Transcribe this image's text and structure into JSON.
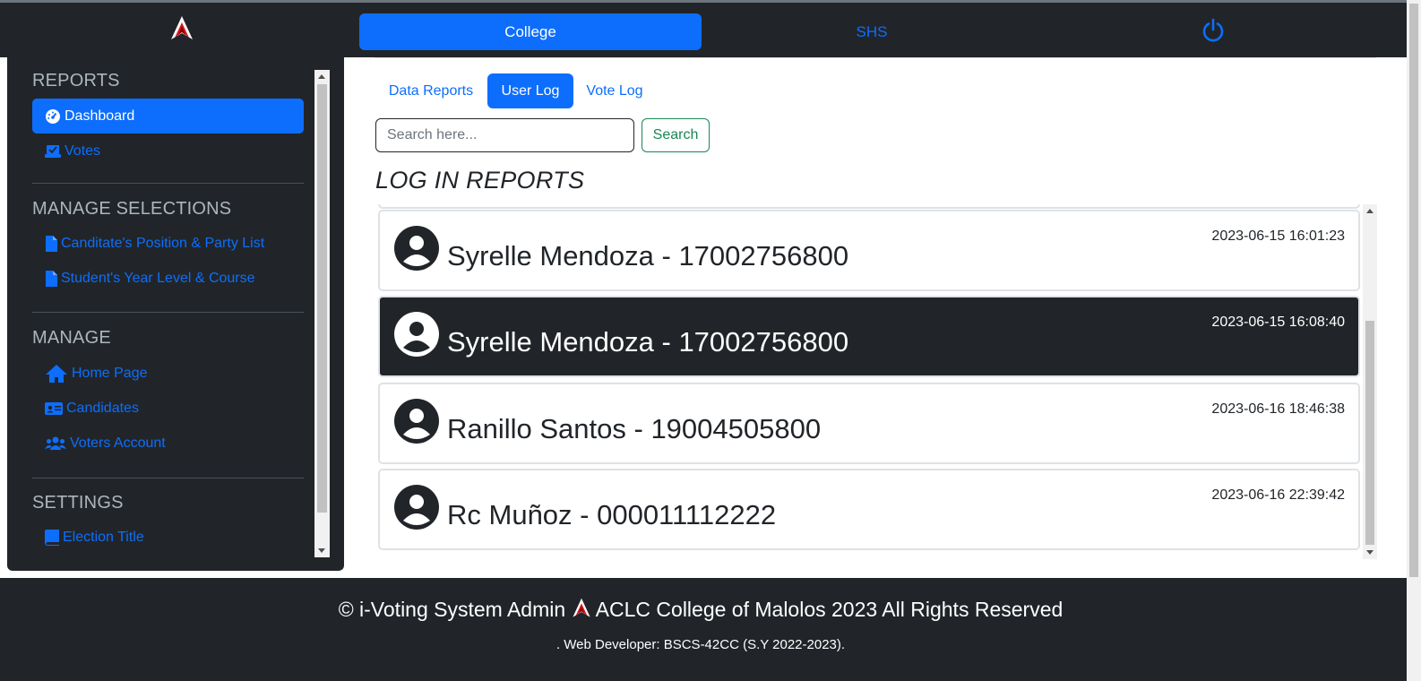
{
  "nav": {
    "tabs": [
      {
        "label": "College",
        "active": true
      },
      {
        "label": "SHS",
        "active": false
      }
    ],
    "logo_icon": "aclc-logo",
    "power_icon": "power-icon"
  },
  "sidebar": {
    "sections": [
      {
        "title": "REPORTS",
        "items": [
          {
            "label": "Dashboard",
            "icon": "gauge-icon",
            "active": true
          },
          {
            "label": "Votes",
            "icon": "ballot-box-icon",
            "active": false
          }
        ]
      },
      {
        "title": "MANAGE SELECTIONS",
        "items": [
          {
            "label": "Canditate's Position & Party List",
            "icon": "file-icon"
          },
          {
            "label": "Student's Year Level & Course",
            "icon": "file-icon"
          }
        ]
      },
      {
        "title": "MANAGE",
        "items": [
          {
            "label": "Home Page",
            "icon": "home-icon"
          },
          {
            "label": "Candidates",
            "icon": "id-card-icon"
          },
          {
            "label": "Voters Account",
            "icon": "users-icon"
          }
        ]
      },
      {
        "title": "SETTINGS",
        "items": [
          {
            "label": "Election Title",
            "icon": "book-icon"
          }
        ]
      }
    ]
  },
  "main": {
    "tabs": [
      {
        "label": "Data Reports",
        "active": false
      },
      {
        "label": "User Log",
        "active": true
      },
      {
        "label": "Vote Log",
        "active": false
      }
    ],
    "search": {
      "placeholder": "Search here...",
      "button": "Search"
    },
    "title": "LOG IN REPORTS",
    "logs": [
      {
        "name": "Syrelle Mendoza - 17002756800",
        "time": "2023-06-15 16:01:23",
        "highlighted": false
      },
      {
        "name": "Syrelle Mendoza - 17002756800",
        "time": "2023-06-15 16:08:40",
        "highlighted": true
      },
      {
        "name": "Ranillo Santos - 19004505800",
        "time": "2023-06-16 18:46:38",
        "highlighted": false
      },
      {
        "name": "Rc Muñoz - 000011112222",
        "time": "2023-06-16 22:39:42",
        "highlighted": false
      }
    ]
  },
  "footer": {
    "copyright_prefix": "© i-Voting System Admin",
    "copyright_suffix": "ACLC College of Malolos 2023 All Rights Reserved",
    "developer": ". Web Developer: BSCS-42CC (S.Y 2022-2023)."
  },
  "colors": {
    "dark": "#212529",
    "primary": "#0d6efd",
    "success": "#198754",
    "muted": "#adb5bd"
  }
}
